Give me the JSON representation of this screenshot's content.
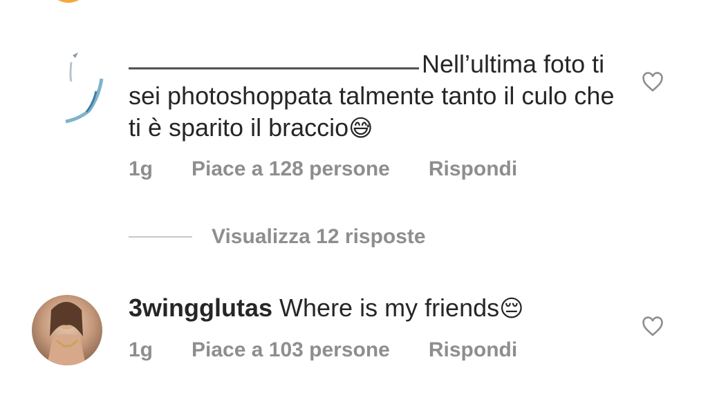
{
  "comments": [
    {
      "username": "",
      "text": "Nell’ultima foto ti sei photoshoppata talmente tanto il culo che ti è sparito il braccio",
      "emoji": "😅",
      "time": "1g",
      "likes": "Piace a 128 persone",
      "reply": "Rispondi"
    },
    {
      "username": "3wingglutas",
      "text": "Where is my friends",
      "emoji": "😔",
      "time": "1g",
      "likes": "Piace a 103 persone",
      "reply": "Rispondi"
    }
  ],
  "replies_toggle": "Visualizza 12 risposte",
  "icons": {
    "like": "heart-outline-icon"
  },
  "colors": {
    "text": "#262626",
    "secondary": "#8e8e8e",
    "divider": "#c7c7c7"
  }
}
